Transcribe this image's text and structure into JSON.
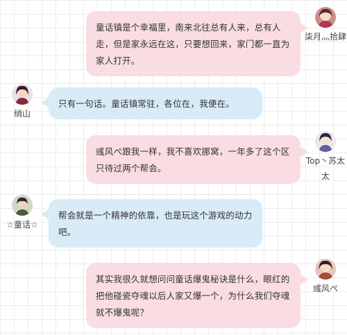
{
  "messages": [
    {
      "side": "right",
      "color": "pink",
      "text": "童话镇是个幸福里，南来北往总有人来，总有人走，但是家永远在这，只要想回来，家门都一直为家人打开。",
      "name": "柒月灬拾肆",
      "avatar_icon": "female-character-avatar-icon"
    },
    {
      "side": "left",
      "color": "blue",
      "text": "只有一句话。童话镇常驻，各位在，我便在。",
      "name": "绡山",
      "avatar_icon": "female-character-avatar-icon"
    },
    {
      "side": "right",
      "color": "pink",
      "text": "彧风ぺ跟我一样，我不喜欢挪窝，一年多了这个区只待过两个帮会。",
      "name": "Top丶苏太太",
      "avatar_icon": "female-character-avatar-icon"
    },
    {
      "side": "left",
      "color": "blue",
      "text": "帮会就是一个精神的依靠，也是玩这个游戏的动力吧。",
      "name": "☆童话☆",
      "avatar_icon": "male-character-avatar-icon"
    },
    {
      "side": "right",
      "color": "pink",
      "text": "其实我很久就想问问童话爆鬼秘诀是什么，眼红的把他碰瓷夺魂以后人家又爆一个，为什么我们夺魂就不爆鬼呢？",
      "name": "彧风ぺ",
      "avatar_icon": "female-character-avatar-icon"
    }
  ],
  "colors": {
    "pink_bubble": "#f9dde2",
    "blue_bubble": "#d8ebf7",
    "text": "#333333",
    "grid": "#ececec"
  }
}
